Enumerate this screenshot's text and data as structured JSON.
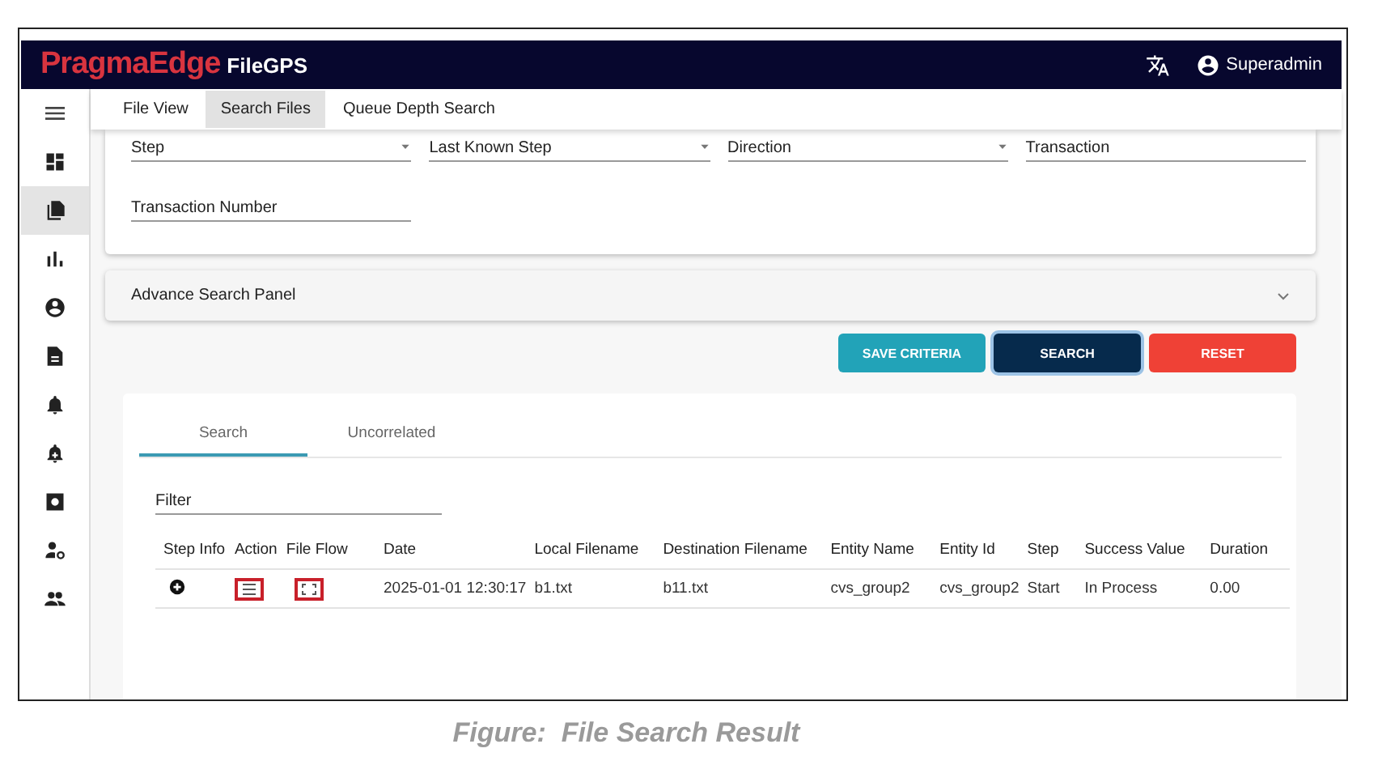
{
  "header": {
    "brand": "PragmaEdge",
    "product": "FileGPS",
    "user": "Superadmin"
  },
  "sidebar": {
    "items": [
      {
        "selected": false
      },
      {
        "selected": true
      },
      {
        "selected": false
      },
      {
        "selected": false
      },
      {
        "selected": false
      },
      {
        "selected": false
      },
      {
        "selected": false
      },
      {
        "selected": false
      },
      {
        "selected": false
      },
      {
        "selected": false
      }
    ]
  },
  "nav_tabs": [
    {
      "label": "File View",
      "selected": false
    },
    {
      "label": "Search Files",
      "selected": true
    },
    {
      "label": "Queue Depth Search",
      "selected": false
    }
  ],
  "criteria": {
    "fields": [
      {
        "label": "Step",
        "kind": "select"
      },
      {
        "label": "Last Known Step",
        "kind": "select"
      },
      {
        "label": "Direction",
        "kind": "select"
      },
      {
        "label": "Transaction",
        "kind": "text"
      },
      {
        "label": "Transaction Number",
        "kind": "text"
      }
    ]
  },
  "advance_panel": {
    "title": "Advance Search Panel",
    "expanded": false
  },
  "buttons": [
    {
      "label": "SAVE CRITERIA",
      "kind": "save"
    },
    {
      "label": "SEARCH",
      "kind": "search"
    },
    {
      "label": "RESET",
      "kind": "reset"
    }
  ],
  "results": {
    "tabs": [
      {
        "label": "Search",
        "selected": true
      },
      {
        "label": "Uncorrelated",
        "selected": false
      }
    ],
    "filter": {
      "placeholder": "Filter"
    },
    "columns": [
      "Step Info",
      "Action",
      "File Flow",
      "Date",
      "Local Filename",
      "Destination Filename",
      "Entity Name",
      "Entity Id",
      "Step",
      "Success Value",
      "Duration"
    ],
    "rows": [
      {
        "cells": [
          "",
          "",
          "",
          "2025-01-01 12:30:17",
          "b1.txt",
          "b11.txt",
          "cvs_group2",
          "cvs_group2",
          "Start",
          "In Process",
          "0.00"
        ]
      }
    ]
  },
  "caption": "Figure:  File Search Result"
}
